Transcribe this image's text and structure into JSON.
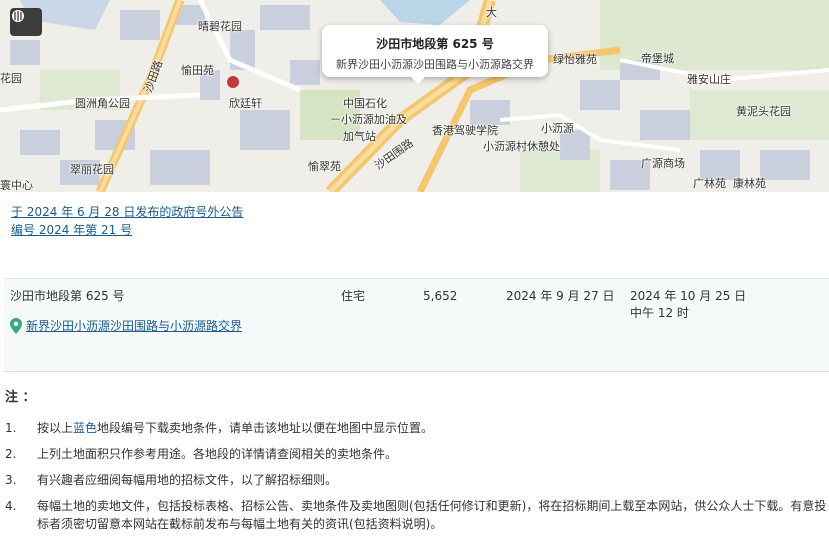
{
  "map": {
    "popup": {
      "title": "沙田市地段第 625 号",
      "subtitle": "新界沙田小沥源沙田围路与小沥源路交界"
    },
    "labels": [
      {
        "id": "l1",
        "text": "晴碧花园"
      },
      {
        "id": "l2",
        "text": "愉田苑"
      },
      {
        "id": "l3",
        "text": "沙田路"
      },
      {
        "id": "l4",
        "text": "欣廷轩"
      },
      {
        "id": "l5",
        "text": "花园"
      },
      {
        "id": "l6",
        "text": "圆洲角公园"
      },
      {
        "id": "l7",
        "text": "中国石化"
      },
      {
        "id": "l8",
        "text": "－小沥源加油及"
      },
      {
        "id": "l9",
        "text": "加气站"
      },
      {
        "id": "l10",
        "text": "香港驾驶学院"
      },
      {
        "id": "l11",
        "text": "沙田围路"
      },
      {
        "id": "l12",
        "text": "愉翠苑"
      },
      {
        "id": "l13",
        "text": "翠丽花园"
      },
      {
        "id": "l14",
        "text": "寰中心"
      },
      {
        "id": "l15",
        "text": "绿怡雅苑"
      },
      {
        "id": "l16",
        "text": "帝堡城"
      },
      {
        "id": "l17",
        "text": "雅安山庄"
      },
      {
        "id": "l18",
        "text": "黄泥头花园"
      },
      {
        "id": "l19",
        "text": "小沥源"
      },
      {
        "id": "l20",
        "text": "小沥源村休憩处"
      },
      {
        "id": "l21",
        "text": "广源商场"
      },
      {
        "id": "l22",
        "text": "广林苑"
      },
      {
        "id": "l23",
        "text": "康林苑"
      },
      {
        "id": "l24",
        "text": "大"
      }
    ]
  },
  "announcement": {
    "line1": "于 2024 年 6 月 28 日发布的政府号外公告",
    "line2": "编号 2024 年第 21 号"
  },
  "lot": {
    "name": "沙田市地段第 625 号",
    "location": "新界沙田小沥源沙田围路与小沥源路交界",
    "use": "住宅",
    "area": "5,652",
    "date1": "2024 年 9 月 27 日",
    "date2": "2024 年 10 月 25 日",
    "time": "中午 12 时"
  },
  "notes": {
    "title": "注 ：",
    "items": [
      {
        "num": "1.",
        "pre": "按以上",
        "blue": "蓝色",
        "post": "地段编号下载卖地条件，请单击该地址以便在地图中显示位置。"
      },
      {
        "num": "2.",
        "text": "上列土地面积只作参考用途。各地段的详情请查阅相关的卖地条件。"
      },
      {
        "num": "3.",
        "text": "有兴趣者应细阅每幅用地的招标文件，以了解招标细则。"
      },
      {
        "num": "4.",
        "text": "每幅土地的卖地文件，包括投标表格、招标公告、卖地条件及卖地图则(包括任何修订和更新)，将在招标期间上载至本网站，供公众人士下载。有意投标者须密切留意本网站在截标前发布与每幅土地有关的资讯(包括资料说明)。"
      }
    ]
  }
}
